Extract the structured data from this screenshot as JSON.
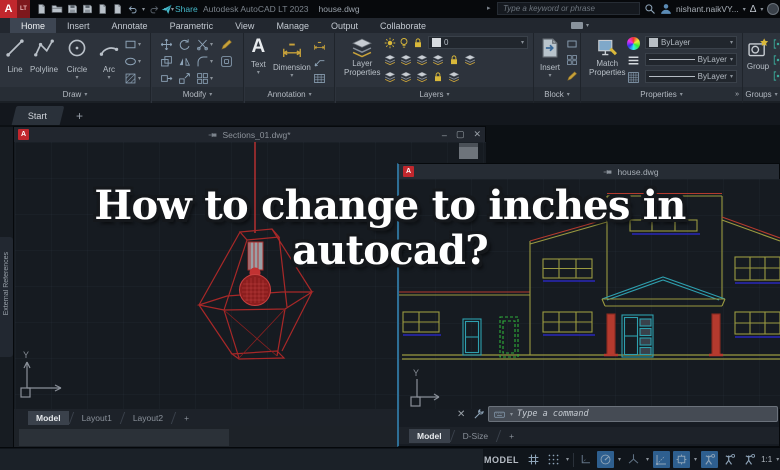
{
  "colors": {
    "accent_red": "#c1272d",
    "share_teal": "#45b8c9",
    "status_highlight_blue": "#2e5f8f",
    "lamp_red": "#b03030",
    "house_yellow": "#9a9a40",
    "house_red": "#b43a2e",
    "house_cyan": "#2e9fae",
    "house_green": "#2fae3a",
    "house_sill_blue": "#2828bb"
  },
  "titlebar": {
    "logo_main": "A",
    "logo_sub": "LT",
    "share": "Share",
    "app_title": "Autodesk AutoCAD LT 2023",
    "doc_title": "house.dwg",
    "search_placeholder": "Type a keyword or phrase",
    "user": "nishant.naikVY..."
  },
  "ribbon_tabs": [
    {
      "label": "Home"
    },
    {
      "label": "Insert"
    },
    {
      "label": "Annotate"
    },
    {
      "label": "Parametric"
    },
    {
      "label": "View"
    },
    {
      "label": "Manage"
    },
    {
      "label": "Output"
    },
    {
      "label": "Collaborate"
    }
  ],
  "panels": {
    "draw": {
      "label": "Draw",
      "line": "Line",
      "polyline": "Polyline",
      "circle": "Circle",
      "arc": "Arc"
    },
    "modify": {
      "label": "Modify"
    },
    "annotation": {
      "label": "Annotation",
      "text": "Text",
      "dimension": "Dimension",
      "big_a": "A"
    },
    "layers": {
      "label": "Layers",
      "current_layer": "0",
      "props_line1": "Layer",
      "props_line2": "Properties"
    },
    "block": {
      "label": "Block",
      "insert": "Insert"
    },
    "properties": {
      "label": "Properties",
      "match_line1": "Match",
      "match_line2": "Properties",
      "bylayer": "ByLayer"
    },
    "groups": {
      "label": "Groups",
      "group": "Group"
    }
  },
  "start_tab": "Start",
  "plus": "+",
  "palette": {
    "label": "External References"
  },
  "overlay": {
    "line1": "How to change to inches in",
    "line2": "autocad?"
  },
  "sections_window": {
    "title": "Sections_01.dwg*",
    "tabs": [
      {
        "label": "Model"
      },
      {
        "label": "Layout1"
      },
      {
        "label": "Layout2"
      }
    ]
  },
  "house_window": {
    "title": "house.dwg",
    "tabs": [
      {
        "label": "Model"
      },
      {
        "label": "D-Size"
      }
    ],
    "command_placeholder": "Type a command"
  },
  "ucs": {
    "y_label": "Y"
  },
  "statusbar": {
    "model": "MODEL",
    "scale": "1:1"
  }
}
